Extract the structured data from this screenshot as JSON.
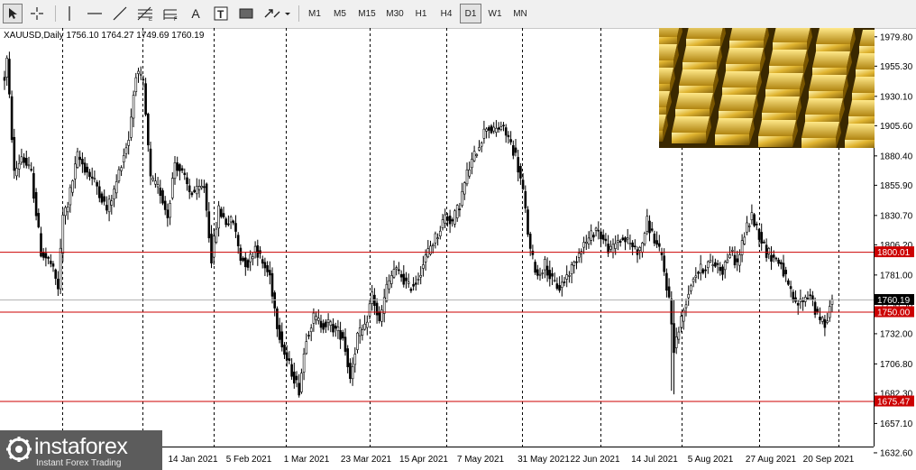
{
  "toolbar": {
    "tools": [
      "cursor-icon",
      "crosshair-icon",
      "vertical-line-icon",
      "horizontal-line-icon",
      "trendline-icon",
      "fibonacci-icon",
      "fibo-expansion-icon",
      "text-icon",
      "text-label-icon",
      "rectangle-icon",
      "arrows-icon"
    ],
    "timeframes": [
      "M1",
      "M5",
      "M15",
      "M30",
      "H1",
      "H4",
      "D1",
      "W1",
      "MN"
    ],
    "active_timeframe": "D1",
    "text_tool": "A",
    "text_label_tool": "T"
  },
  "symbol_label": "XAUUSD,Daily  1756.10 1764.27 1749.69 1760.19",
  "logo": {
    "name": "instaforex",
    "tagline": "Instant Forex Trading"
  },
  "colors": {
    "bull": "#ffffff",
    "bear": "#000000",
    "level_line": "#cc0000",
    "current_price_line": "#b4b4b4",
    "grid": "#000000"
  },
  "chart_data": {
    "type": "candlestick",
    "symbol": "XAUUSD",
    "timeframe": "Daily",
    "ohlc_last": {
      "open": 1756.1,
      "high": 1764.27,
      "low": 1749.69,
      "close": 1760.19
    },
    "ylim": [
      1626,
      1987
    ],
    "y_ticks": [
      1979.8,
      1955.3,
      1930.1,
      1905.6,
      1880.4,
      1855.9,
      1830.7,
      1806.2,
      1781.0,
      1756.5,
      1732.0,
      1706.8,
      1682.3,
      1657.1,
      1632.6
    ],
    "x_ticks": [
      "2 Nov 2020",
      "14 Jan 2021",
      "5 Feb 2021",
      "1 Mar 2021",
      "23 Mar 2021",
      "15 Apr 2021",
      "7 May 2021",
      "31 May 2021",
      "22 Jun 2021",
      "14 Jul 2021",
      "5 Aug 2021",
      "27 Aug 2021",
      "20 Sep 2021"
    ],
    "hidden_x_ticks": [
      0
    ],
    "levels": [
      {
        "price": 1800.01,
        "label": "1800.01"
      },
      {
        "price": 1750.0,
        "label": "1750.00"
      },
      {
        "price": 1675.47,
        "label": "1675.47"
      }
    ],
    "current_price": {
      "price": 1760.19,
      "label": "1760.19"
    },
    "anchors": [
      [
        0,
        1945
      ],
      [
        1,
        1960
      ],
      [
        4,
        1865
      ],
      [
        7,
        1880
      ],
      [
        11,
        1865
      ],
      [
        15,
        1800
      ],
      [
        19,
        1790
      ],
      [
        22,
        1770
      ],
      [
        24,
        1830
      ],
      [
        26,
        1840
      ],
      [
        30,
        1880
      ],
      [
        33,
        1870
      ],
      [
        38,
        1855
      ],
      [
        42,
        1835
      ],
      [
        45,
        1850
      ],
      [
        48,
        1875
      ],
      [
        51,
        1895
      ],
      [
        54,
        1950
      ],
      [
        57,
        1940
      ],
      [
        60,
        1860
      ],
      [
        64,
        1850
      ],
      [
        67,
        1830
      ],
      [
        70,
        1875
      ],
      [
        73,
        1865
      ],
      [
        76,
        1850
      ],
      [
        79,
        1850
      ],
      [
        82,
        1855
      ],
      [
        85,
        1795
      ],
      [
        88,
        1835
      ],
      [
        91,
        1825
      ],
      [
        94,
        1825
      ],
      [
        97,
        1795
      ],
      [
        100,
        1790
      ],
      [
        103,
        1805
      ],
      [
        106,
        1790
      ],
      [
        109,
        1780
      ],
      [
        112,
        1740
      ],
      [
        115,
        1715
      ],
      [
        118,
        1700
      ],
      [
        121,
        1685
      ],
      [
        124,
        1730
      ],
      [
        127,
        1745
      ],
      [
        130,
        1740
      ],
      [
        133,
        1740
      ],
      [
        136,
        1735
      ],
      [
        139,
        1730
      ],
      [
        142,
        1695
      ],
      [
        145,
        1730
      ],
      [
        148,
        1735
      ],
      [
        151,
        1765
      ],
      [
        154,
        1740
      ],
      [
        157,
        1770
      ],
      [
        160,
        1785
      ],
      [
        163,
        1780
      ],
      [
        166,
        1770
      ],
      [
        169,
        1775
      ],
      [
        172,
        1790
      ],
      [
        175,
        1805
      ],
      [
        178,
        1815
      ],
      [
        181,
        1830
      ],
      [
        184,
        1825
      ],
      [
        187,
        1840
      ],
      [
        190,
        1865
      ],
      [
        193,
        1880
      ],
      [
        196,
        1895
      ],
      [
        198,
        1905
      ],
      [
        201,
        1900
      ],
      [
        204,
        1905
      ],
      [
        207,
        1895
      ],
      [
        210,
        1880
      ],
      [
        213,
        1850
      ],
      [
        216,
        1800
      ],
      [
        219,
        1780
      ],
      [
        222,
        1790
      ],
      [
        225,
        1775
      ],
      [
        228,
        1770
      ],
      [
        231,
        1780
      ],
      [
        234,
        1790
      ],
      [
        237,
        1805
      ],
      [
        240,
        1810
      ],
      [
        243,
        1820
      ],
      [
        246,
        1810
      ],
      [
        249,
        1800
      ],
      [
        252,
        1810
      ],
      [
        255,
        1810
      ],
      [
        258,
        1805
      ],
      [
        261,
        1800
      ],
      [
        264,
        1825
      ],
      [
        267,
        1810
      ],
      [
        270,
        1795
      ],
      [
        273,
        1760
      ],
      [
        275,
        1720
      ],
      [
        277,
        1735
      ],
      [
        280,
        1760
      ],
      [
        283,
        1780
      ],
      [
        286,
        1785
      ],
      [
        289,
        1790
      ],
      [
        292,
        1790
      ],
      [
        295,
        1785
      ],
      [
        298,
        1800
      ],
      [
        301,
        1790
      ],
      [
        304,
        1815
      ],
      [
        307,
        1830
      ],
      [
        310,
        1815
      ],
      [
        313,
        1800
      ],
      [
        316,
        1795
      ],
      [
        319,
        1790
      ],
      [
        322,
        1770
      ],
      [
        325,
        1755
      ],
      [
        328,
        1760
      ],
      [
        331,
        1765
      ],
      [
        334,
        1745
      ],
      [
        337,
        1740
      ],
      [
        340,
        1760
      ]
    ]
  }
}
